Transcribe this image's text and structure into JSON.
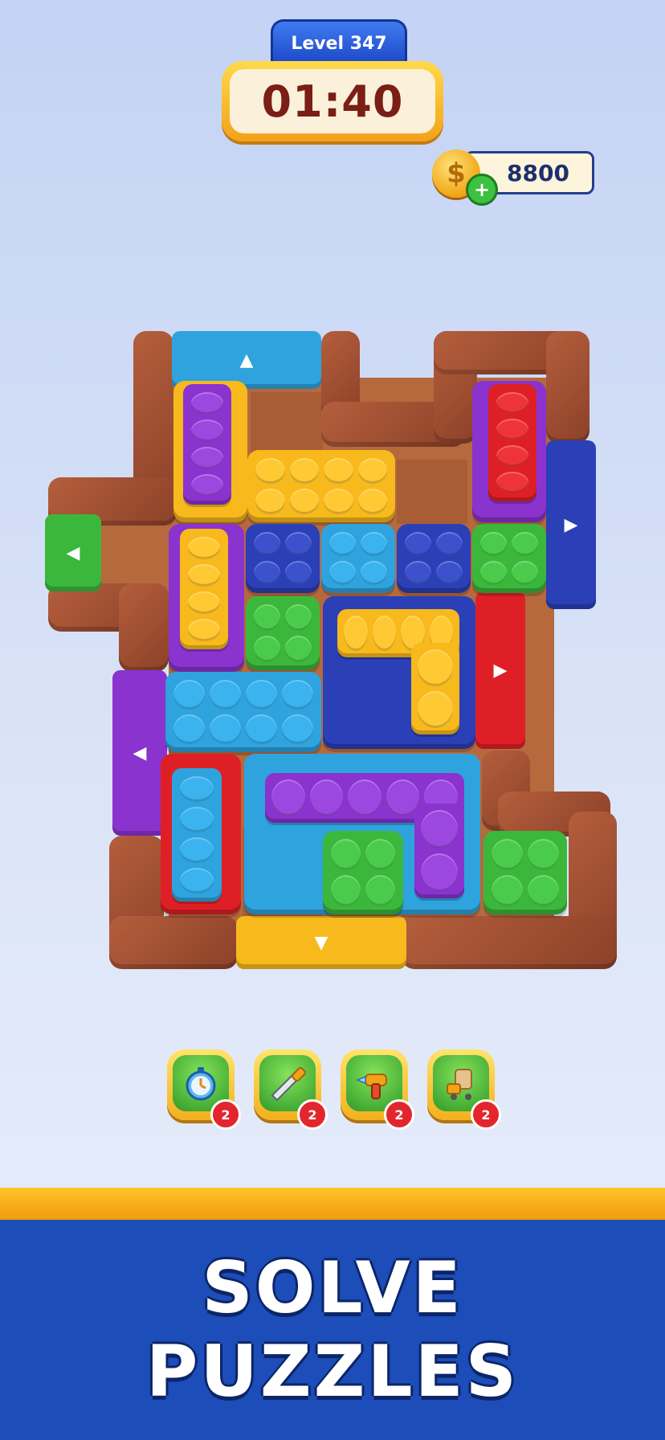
{
  "header": {
    "level_label": "Level 347",
    "timer": "01:40",
    "coins": "8800",
    "coin_symbol": "$",
    "coin_add": "+"
  },
  "board": {
    "exit_gates": [
      {
        "color": "#2fa3de",
        "arrow": "▲",
        "direction": "up"
      },
      {
        "color": "#3bb83c",
        "arrow": "◀",
        "direction": "left"
      },
      {
        "color": "#2b3fb7",
        "arrow": "▶",
        "direction": "right"
      },
      {
        "color": "#de2026",
        "arrow": "▶",
        "direction": "right"
      },
      {
        "color": "#8a33cf",
        "arrow": "◀",
        "direction": "left"
      },
      {
        "color": "#f7b91c",
        "arrow": "▼",
        "direction": "down"
      }
    ]
  },
  "boosters": [
    {
      "name": "stopwatch-icon",
      "count": "2"
    },
    {
      "name": "saw-icon",
      "count": "2"
    },
    {
      "name": "drill-icon",
      "count": "2"
    },
    {
      "name": "vacuum-icon",
      "count": "2"
    }
  ],
  "banner": {
    "line1": "SOLVE",
    "line2": "PUZZLES"
  },
  "colors": {
    "blue": "#2fa3de",
    "navy": "#2b3fb7",
    "yellow": "#f7b91c",
    "purple": "#8a33cf",
    "green": "#3bb83c",
    "red": "#de2026",
    "wood": "#9c4b30",
    "banner": "#1c4db8"
  }
}
